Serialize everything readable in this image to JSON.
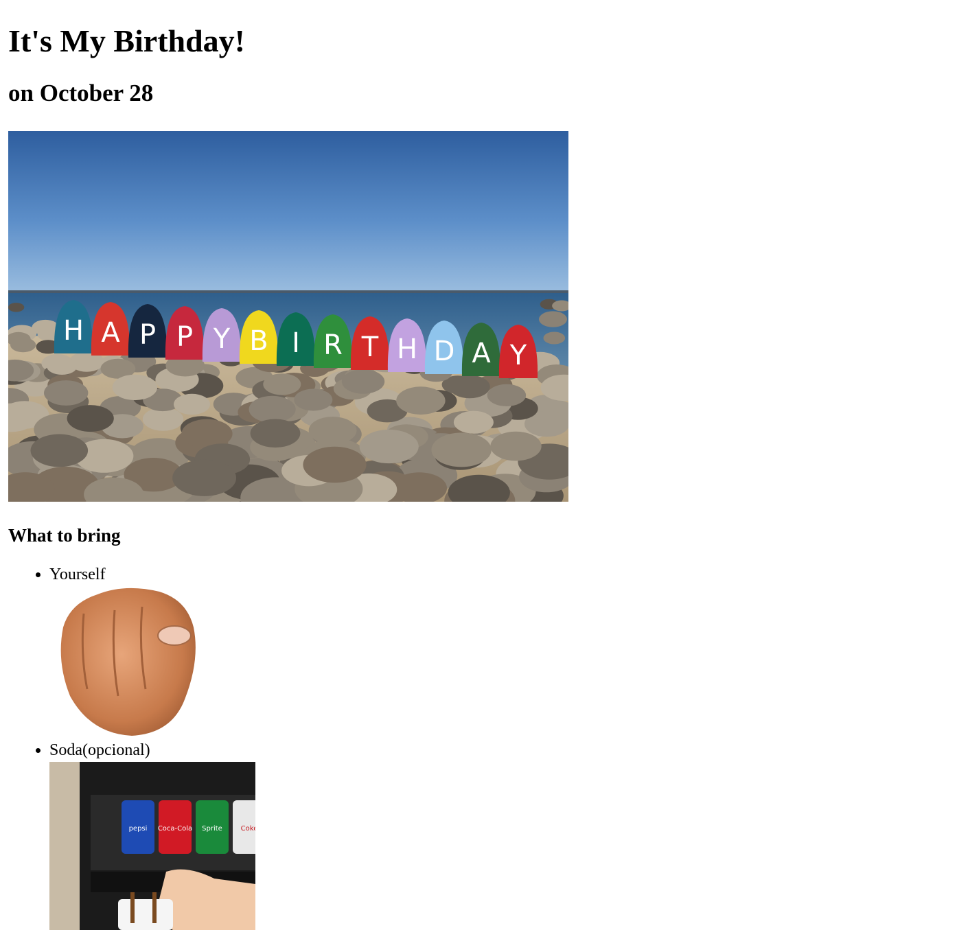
{
  "page": {
    "title": "It's My Birthday!",
    "subtitle": "on October 28"
  },
  "hero": {
    "letters": [
      "H",
      "A",
      "P",
      "P",
      "Y",
      "B",
      "I",
      "R",
      "T",
      "H",
      "D",
      "A",
      "Y"
    ],
    "letter_colors": [
      "#1f6e8c",
      "#d6362d",
      "#15263f",
      "#c6283d",
      "#b89ad6",
      "#f0d81e",
      "#0c6e53",
      "#2f8f3c",
      "#d42c29",
      "#c2a2e0",
      "#8fc4ec",
      "#2f6b3a",
      "#d1262b"
    ]
  },
  "bring": {
    "heading": "What to bring",
    "items": [
      {
        "label": "Yourself"
      },
      {
        "label": "Soda(opcional)"
      }
    ]
  },
  "soda": {
    "brands": [
      "pepsi",
      "Coca-Cola",
      "Sprite",
      "Coke"
    ],
    "brand_colors": [
      "#1e4bb4",
      "#d11a25",
      "#1a8a3b",
      "#e8e8e8"
    ]
  }
}
